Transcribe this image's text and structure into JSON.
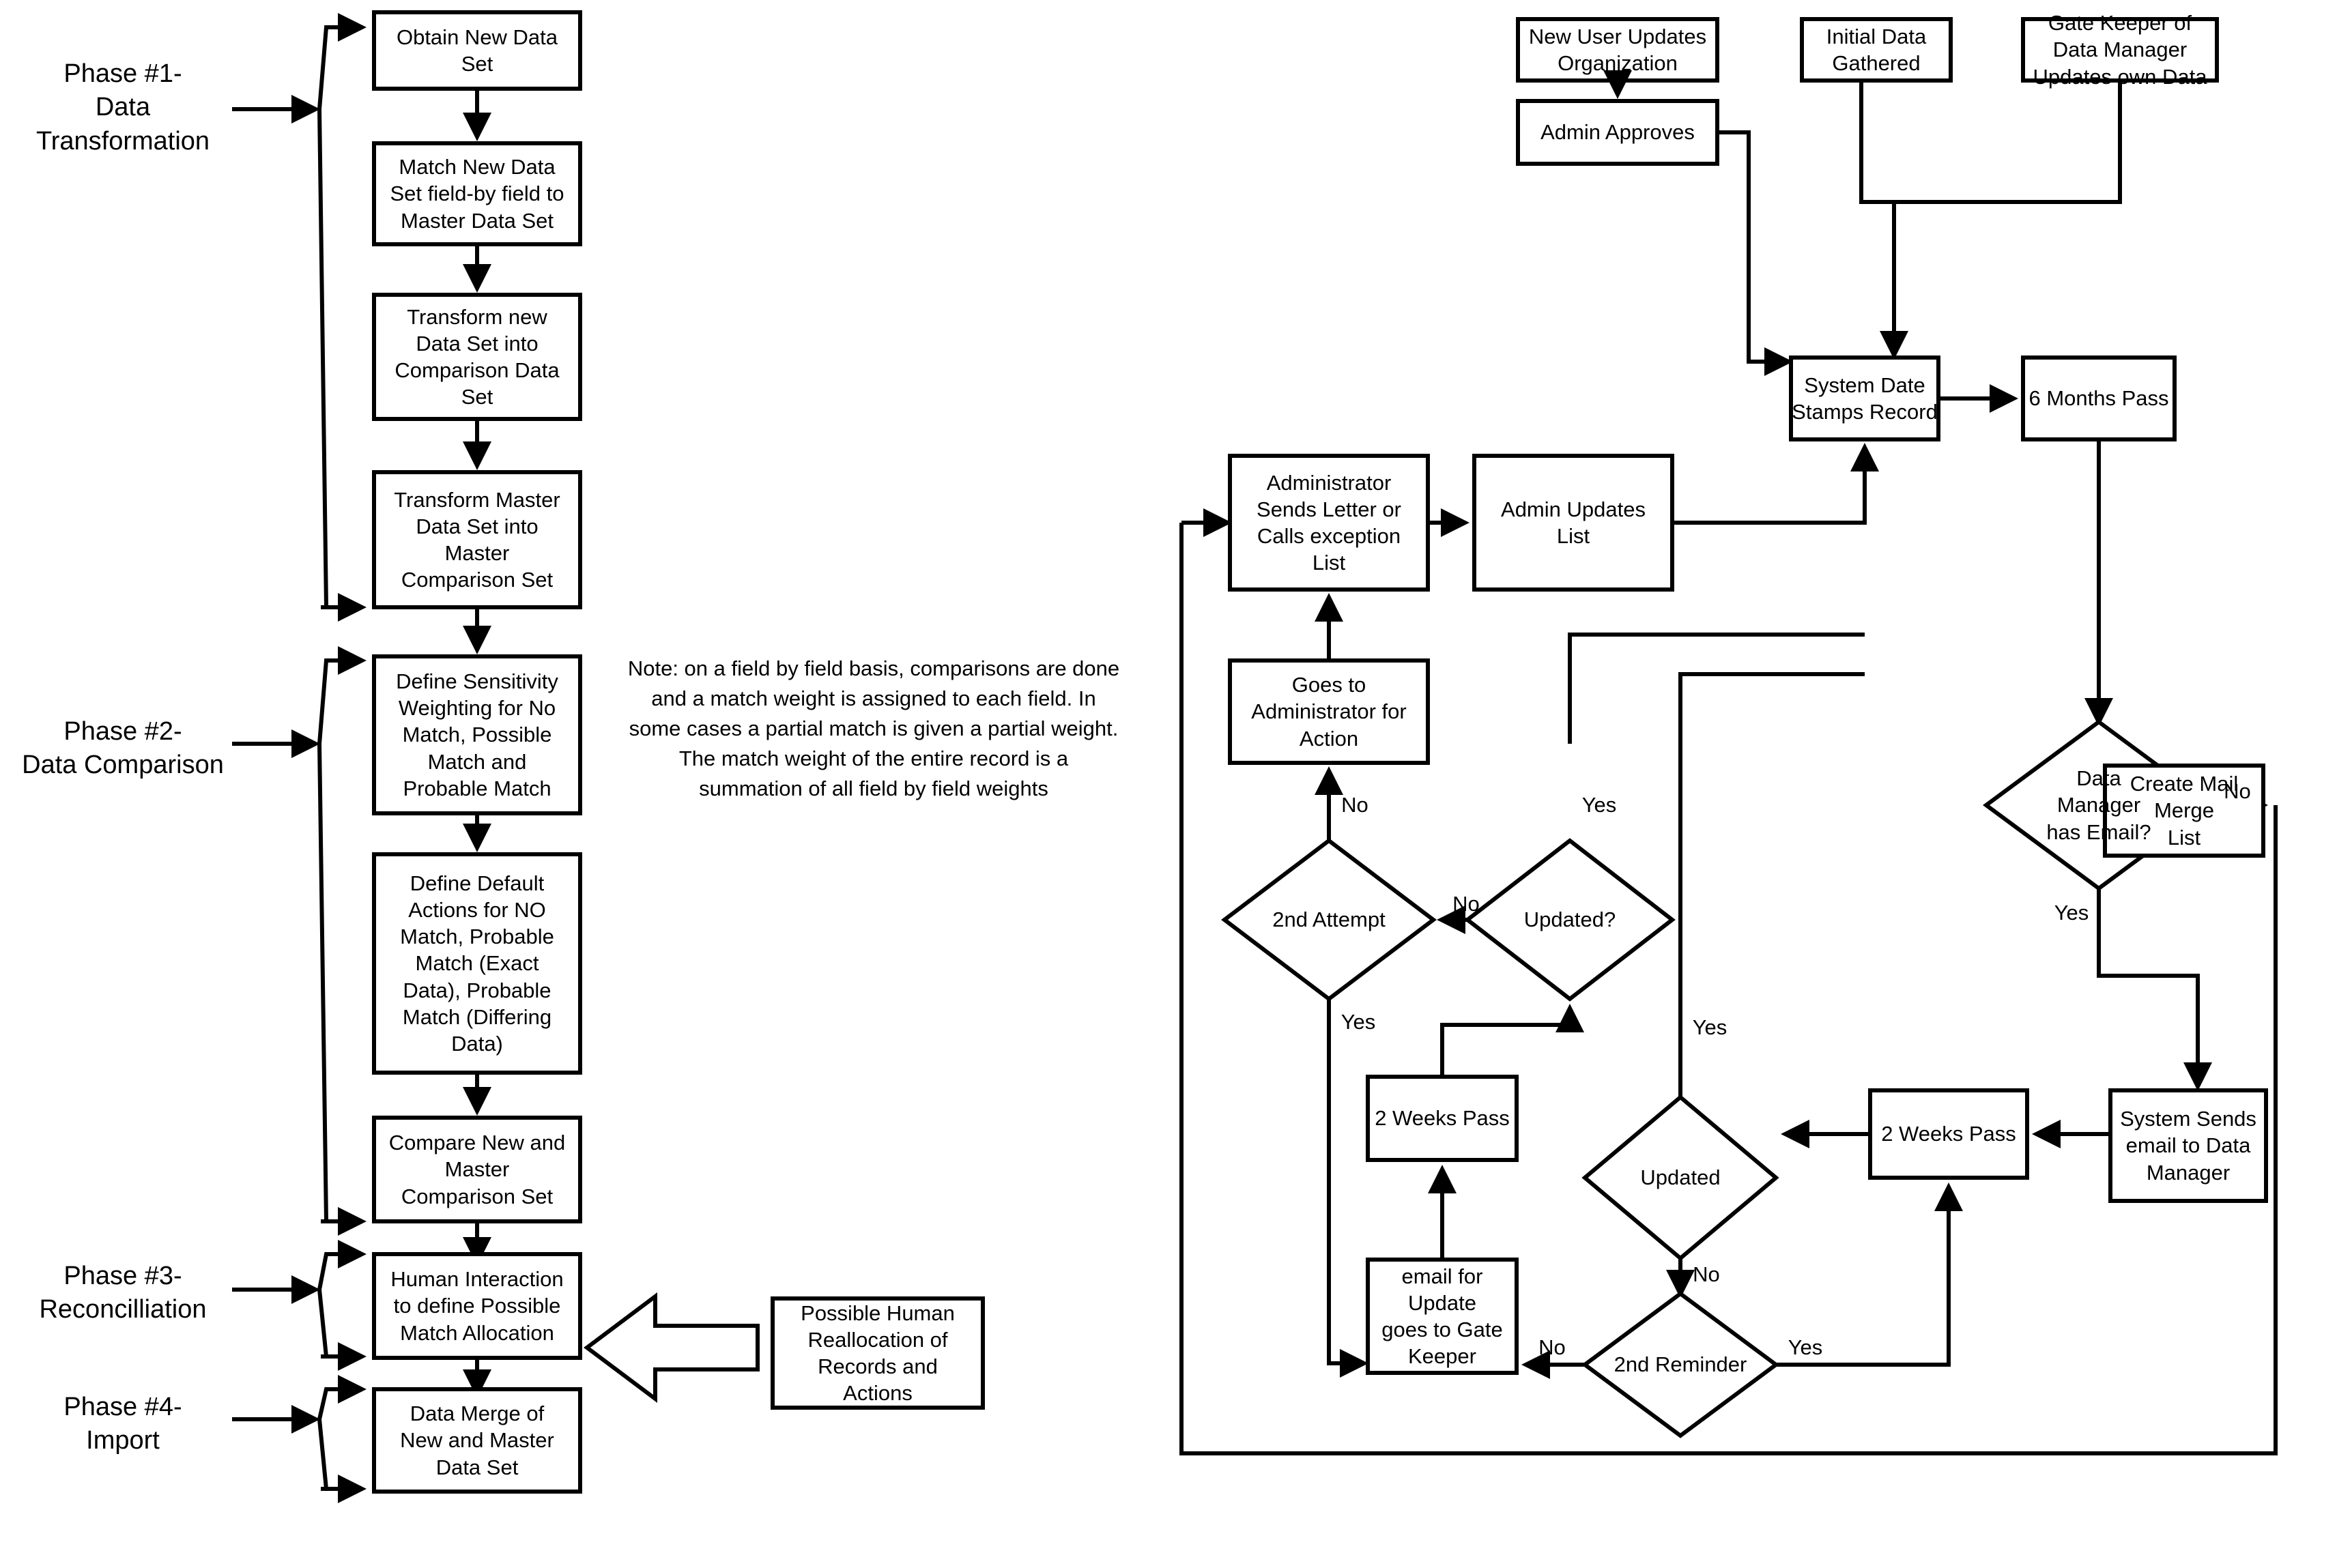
{
  "left_flowchart": {
    "phases": [
      {
        "id": "phase1",
        "label": "Phase #1-\nData\nTransformation"
      },
      {
        "id": "phase2",
        "label": "Phase #2-\nData Comparison"
      },
      {
        "id": "phase3",
        "label": "Phase #3-\nReconcilliation"
      },
      {
        "id": "phase4",
        "label": "Phase #4-\nImport"
      }
    ],
    "nodes": [
      {
        "id": "obtain-new-data-set",
        "label": "Obtain New Data\nSet"
      },
      {
        "id": "match-new-data-set",
        "label": "Match New Data\nSet field-by field to\nMaster Data Set"
      },
      {
        "id": "transform-new-data-set",
        "label": "Transform new\nData Set into\nComparison Data\nSet"
      },
      {
        "id": "transform-master-data-set",
        "label": "Transform Master\nData Set into\nMaster\nComparison Set"
      },
      {
        "id": "define-sensitivity-weighting",
        "label": "Define Sensitivity\nWeighting for No\nMatch, Possible\nMatch and\nProbable Match"
      },
      {
        "id": "define-default-actions",
        "label": "Define Default\nActions for NO\nMatch, Probable\nMatch (Exact\nData), Probable\nMatch (Differing\nData)"
      },
      {
        "id": "compare-new-and-master",
        "label": "Compare New and\nMaster\nComparison Set"
      },
      {
        "id": "human-interaction",
        "label": "Human Interaction\nto define Possible\nMatch Allocation"
      },
      {
        "id": "data-merge",
        "label": "Data Merge of\nNew and Master\nData Set"
      },
      {
        "id": "possible-human-reallocation",
        "label": "Possible Human\nReallocation of\nRecords and\nActions"
      }
    ],
    "note": "Note: on a field by field basis, comparisons are done and a match weight is assigned to each field.  In some cases a partial match is given a partial weight.  The match weight of the entire record is a summation of all field by field weights"
  },
  "right_flowchart": {
    "nodes": [
      {
        "id": "new-user-updates-organization",
        "label": "New User Updates\nOrganization"
      },
      {
        "id": "initial-data-gathered",
        "label": "Initial Data\nGathered"
      },
      {
        "id": "gate-keeper-updates-own-data",
        "label": "Gate Keeper of\nData Manager\nUpdates own Data"
      },
      {
        "id": "admin-approves",
        "label": "Admin Approves"
      },
      {
        "id": "system-date-stamps-record",
        "label": "System Date\nStamps Record"
      },
      {
        "id": "six-months-pass",
        "label": "6 Months Pass"
      },
      {
        "id": "administrator-sends-letter",
        "label": "Administrator\nSends Letter or\nCalls exception\nList"
      },
      {
        "id": "admin-updates-list",
        "label": "Admin Updates\nList"
      },
      {
        "id": "goes-to-administrator-for-action",
        "label": "Goes to\nAdministrator for\nAction"
      },
      {
        "id": "create-mail-merge-list",
        "label": "Create Mail\nMerge\nList"
      },
      {
        "id": "two-weeks-pass-left",
        "label": "2 Weeks Pass"
      },
      {
        "id": "two-weeks-pass-right",
        "label": "2 Weeks Pass"
      },
      {
        "id": "system-sends-email-to-data-manager",
        "label": "System Sends\nemail to Data\nManager"
      },
      {
        "id": "email-for-update-goes-to-gate-keeper",
        "label": "email for\nUpdate\ngoes to Gate\nKeeper"
      }
    ],
    "decisions": [
      {
        "id": "data-manager-has-email",
        "label": "Data\nManager\nhas Email?"
      },
      {
        "id": "second-attempt",
        "label": "2nd Attempt"
      },
      {
        "id": "updated-question",
        "label": "Updated?"
      },
      {
        "id": "updated",
        "label": "Updated"
      },
      {
        "id": "second-reminder",
        "label": "2nd Reminder"
      }
    ],
    "edge_labels": [
      {
        "id": "edge-2nd-attempt-no",
        "label": "No"
      },
      {
        "id": "edge-updated-question-yes",
        "label": "Yes"
      },
      {
        "id": "edge-updated-question-no",
        "label": "No"
      },
      {
        "id": "edge-2nd-attempt-yes",
        "label": "Yes"
      },
      {
        "id": "edge-data-manager-has-email-no",
        "label": "No"
      },
      {
        "id": "edge-data-manager-has-email-yes",
        "label": "Yes"
      },
      {
        "id": "edge-updated-yes",
        "label": "Yes"
      },
      {
        "id": "edge-updated-no",
        "label": "No"
      },
      {
        "id": "edge-2nd-reminder-no",
        "label": "No"
      },
      {
        "id": "edge-2nd-reminder-yes",
        "label": "Yes"
      }
    ]
  },
  "colors": {
    "stroke": "#000000",
    "fill": "#ffffff",
    "background": "#ffffff"
  }
}
